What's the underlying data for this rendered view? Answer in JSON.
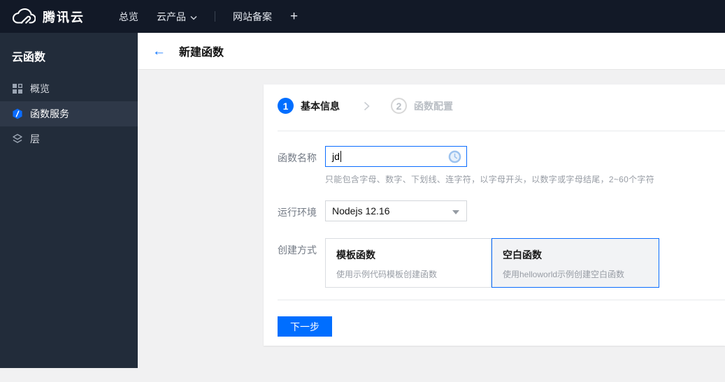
{
  "topbar": {
    "brand": "腾讯云",
    "nav": [
      "总览",
      "云产品",
      "网站备案",
      "+"
    ]
  },
  "sidebar": {
    "title": "云函数",
    "items": [
      {
        "label": "概览",
        "icon": "grid-icon",
        "selected": false
      },
      {
        "label": "函数服务",
        "icon": "function-hexagon-icon",
        "selected": true
      },
      {
        "label": "层",
        "icon": "layers-icon",
        "selected": false
      }
    ]
  },
  "header": {
    "back_icon": "←",
    "title": "新建函数"
  },
  "wizard": {
    "steps": [
      {
        "num": "1",
        "label": "基本信息",
        "active": true
      },
      {
        "num": "2",
        "label": "函数配置",
        "active": false
      }
    ]
  },
  "form": {
    "name_label": "函数名称",
    "name_value": "jd",
    "name_help": "只能包含字母、数字、下划线、连字符，以字母开头，以数字或字母结尾，2~60个字符",
    "runtime_label": "运行环境",
    "runtime_value": "Nodejs 12.16",
    "method_label": "创建方式",
    "methods": [
      {
        "title": "模板函数",
        "desc": "使用示例代码模板创建函数",
        "selected": false
      },
      {
        "title": "空白函数",
        "desc": "使用helloworld示例创建空白函数",
        "selected": true
      }
    ],
    "next_label": "下一步"
  },
  "colors": {
    "accent": "#006eff",
    "topbar_bg": "#121927",
    "sidebar_bg": "#222c3a",
    "sidebar_selected_bg": "#2e3848",
    "content_bg": "#f1f1f2",
    "input_focus_border": "#0b6dff"
  }
}
